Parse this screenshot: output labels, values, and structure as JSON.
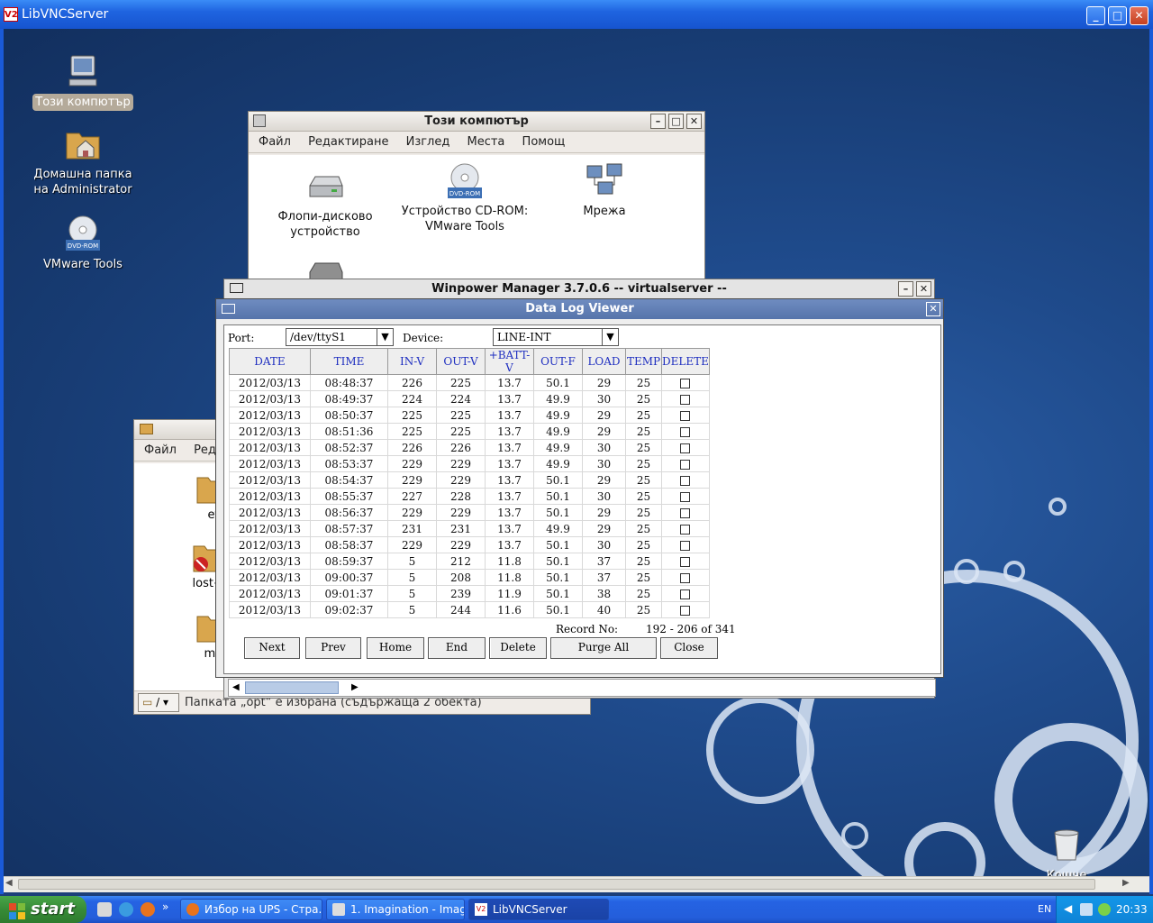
{
  "vnc_window": {
    "title": "LibVNCServer",
    "logo": "V2"
  },
  "desktop_icons": [
    {
      "label": "Този компютър"
    },
    {
      "label": "Домашна папка на Administrator"
    },
    {
      "label": "VMware Tools",
      "badge": "DVD-ROM"
    }
  ],
  "computer_window": {
    "title": "Този компютър",
    "menu": [
      "Файл",
      "Редактиране",
      "Изглед",
      "Места",
      "Помощ"
    ],
    "items": [
      {
        "label": "Флопи-дисково устройство"
      },
      {
        "label": "Устройство CD-ROM: VMware Tools",
        "badge": "DVD-ROM"
      },
      {
        "label": "Мрежа"
      }
    ]
  },
  "file_window": {
    "menu": [
      "Файл",
      "Реда"
    ],
    "items": [
      "et",
      "lost+f",
      "mn"
    ],
    "path_button": "/",
    "status": "Папката „opt“ е избрана (съдържаща 2 обекта)"
  },
  "winpower": {
    "title": "Winpower Manager 3.7.0.6 -- virtualserver --"
  },
  "data_log_viewer": {
    "title": "Data Log Viewer",
    "port_label": "Port:",
    "port_value": "/dev/ttyS1",
    "device_label": "Device:",
    "device_value": "LINE-INT",
    "columns": [
      "DATE",
      "TIME",
      "IN-V",
      "OUT-V",
      "+BATT-V",
      "OUT-F",
      "LOAD",
      "TEMP",
      "DELETE"
    ],
    "rows": [
      [
        "2012/03/13",
        "08:48:37",
        "226",
        "225",
        "13.7",
        "50.1",
        "29",
        "25"
      ],
      [
        "2012/03/13",
        "08:49:37",
        "224",
        "224",
        "13.7",
        "49.9",
        "30",
        "25"
      ],
      [
        "2012/03/13",
        "08:50:37",
        "225",
        "225",
        "13.7",
        "49.9",
        "29",
        "25"
      ],
      [
        "2012/03/13",
        "08:51:36",
        "225",
        "225",
        "13.7",
        "49.9",
        "29",
        "25"
      ],
      [
        "2012/03/13",
        "08:52:37",
        "226",
        "226",
        "13.7",
        "49.9",
        "30",
        "25"
      ],
      [
        "2012/03/13",
        "08:53:37",
        "229",
        "229",
        "13.7",
        "49.9",
        "30",
        "25"
      ],
      [
        "2012/03/13",
        "08:54:37",
        "229",
        "229",
        "13.7",
        "50.1",
        "29",
        "25"
      ],
      [
        "2012/03/13",
        "08:55:37",
        "227",
        "228",
        "13.7",
        "50.1",
        "30",
        "25"
      ],
      [
        "2012/03/13",
        "08:56:37",
        "229",
        "229",
        "13.7",
        "50.1",
        "29",
        "25"
      ],
      [
        "2012/03/13",
        "08:57:37",
        "231",
        "231",
        "13.7",
        "49.9",
        "29",
        "25"
      ],
      [
        "2012/03/13",
        "08:58:37",
        "229",
        "229",
        "13.7",
        "50.1",
        "30",
        "25"
      ],
      [
        "2012/03/13",
        "08:59:37",
        "5",
        "212",
        "11.8",
        "50.1",
        "37",
        "25"
      ],
      [
        "2012/03/13",
        "09:00:37",
        "5",
        "208",
        "11.8",
        "50.1",
        "37",
        "25"
      ],
      [
        "2012/03/13",
        "09:01:37",
        "5",
        "239",
        "11.9",
        "50.1",
        "38",
        "25"
      ],
      [
        "2012/03/13",
        "09:02:37",
        "5",
        "244",
        "11.6",
        "50.1",
        "40",
        "25"
      ]
    ],
    "record_label": "Record No:",
    "record_value": "192 - 206 of 341",
    "buttons": [
      "Next",
      "Prev",
      "Home",
      "End",
      "Delete",
      "Purge All",
      "Close"
    ]
  },
  "recycle_bin": {
    "label": "Кошче"
  },
  "taskbar": {
    "start": "start",
    "tasks": [
      "Избор на UPS - Стра...",
      "1. Imagination - Imag...",
      "LibVNCServer"
    ],
    "lang": "EN",
    "clock": "20:33"
  },
  "colors": {
    "desktop": "#1f4b8c",
    "taskbar": "#245edb",
    "title_dlv": "#5674ab",
    "header_text": "#1f2fc0"
  }
}
